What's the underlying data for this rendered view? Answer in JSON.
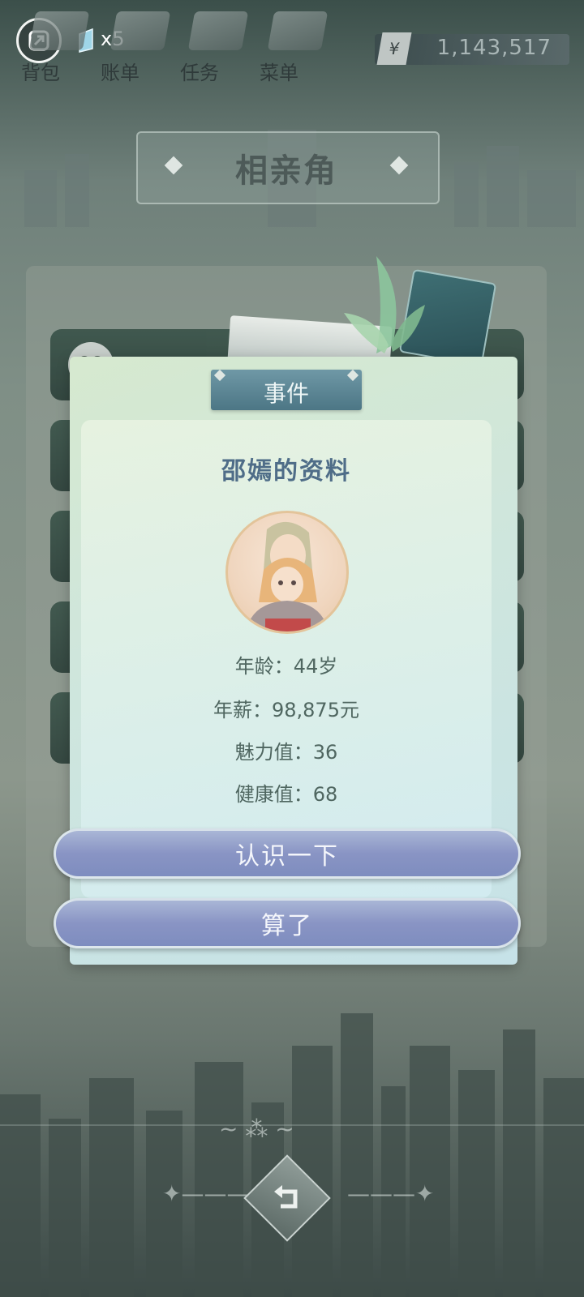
{
  "hud": {
    "gem_count": "x5",
    "money": "1,143,517",
    "currency_symbol": "¥",
    "nav": [
      {
        "label": "背包"
      },
      {
        "label": "账单"
      },
      {
        "label": "任务"
      },
      {
        "label": "菜单"
      }
    ]
  },
  "page": {
    "title": "相亲角"
  },
  "dialog": {
    "tab_label": "事件",
    "profile_title": "邵嫣的资料",
    "stats": {
      "age": "年龄：44岁",
      "salary": "年薪：98,875元",
      "charm": "魅力值：36",
      "health": "健康值：68"
    },
    "buttons": {
      "meet": "认识一下",
      "decline": "算了"
    }
  }
}
